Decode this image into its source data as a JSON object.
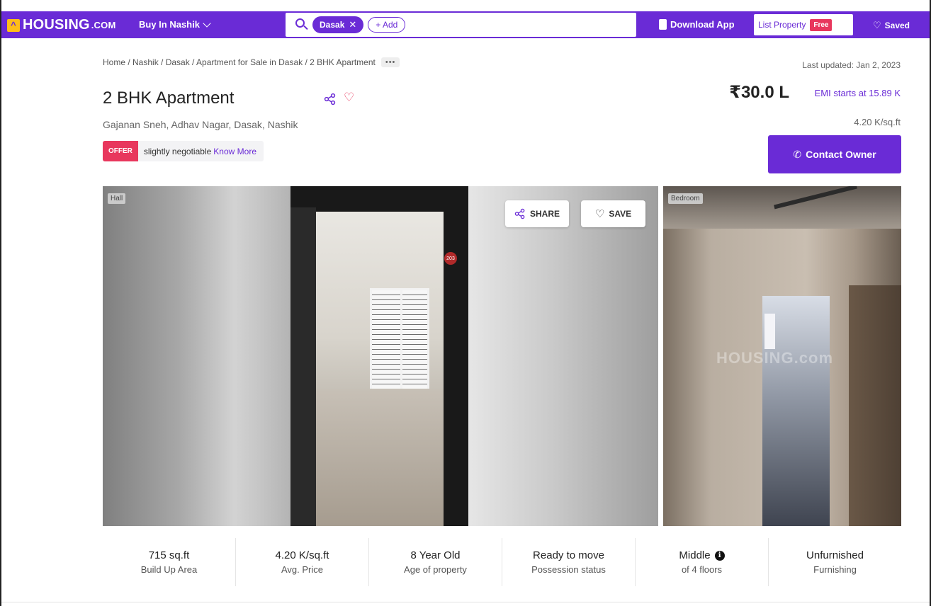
{
  "nav": {
    "logo_text": "HOUSING",
    "logo_suffix": ".COM",
    "city_label": "Buy In Nashik",
    "search_chip": "Dasak",
    "add_label": "+ Add",
    "download_app": "Download App",
    "list_property": "List Property",
    "free_badge": "Free",
    "saved": "Saved",
    "brand_color": "#6a2bd6",
    "accent_color": "#e8375d"
  },
  "breadcrumb": {
    "path": "Home / Nashik / Dasak / Apartment for Sale in Dasak / 2 BHK Apartment",
    "more": "•••"
  },
  "last_updated": "Last updated: Jan 2, 2023",
  "listing": {
    "title": "2 BHK Apartment",
    "address": "Gajanan Sneh, Adhav Nagar, Dasak, Nashik",
    "offer_tag": "OFFER",
    "offer_text": "slightly negotiable",
    "know_more": "Know More",
    "price": "₹30.0 L",
    "emi": "EMI starts at  15.89 K",
    "price_per_sqft": "4.20 K/sq.ft",
    "contact_button": "Contact Owner"
  },
  "gallery": {
    "main_label": "Hall",
    "side_label": "Bedroom",
    "share_button": "SHARE",
    "save_button": "SAVE",
    "door_number": "203",
    "watermark": "HOUSING.com"
  },
  "stats": [
    {
      "value": "715 sq.ft",
      "label": "Build Up Area"
    },
    {
      "value": "4.20 K/sq.ft",
      "label": "Avg. Price"
    },
    {
      "value": "8 Year Old",
      "label": "Age of property"
    },
    {
      "value": "Ready to move",
      "label": "Possession status"
    },
    {
      "value": "Middle",
      "label": "of 4 floors"
    },
    {
      "value": "Unfurnished",
      "label": "Furnishing"
    }
  ]
}
